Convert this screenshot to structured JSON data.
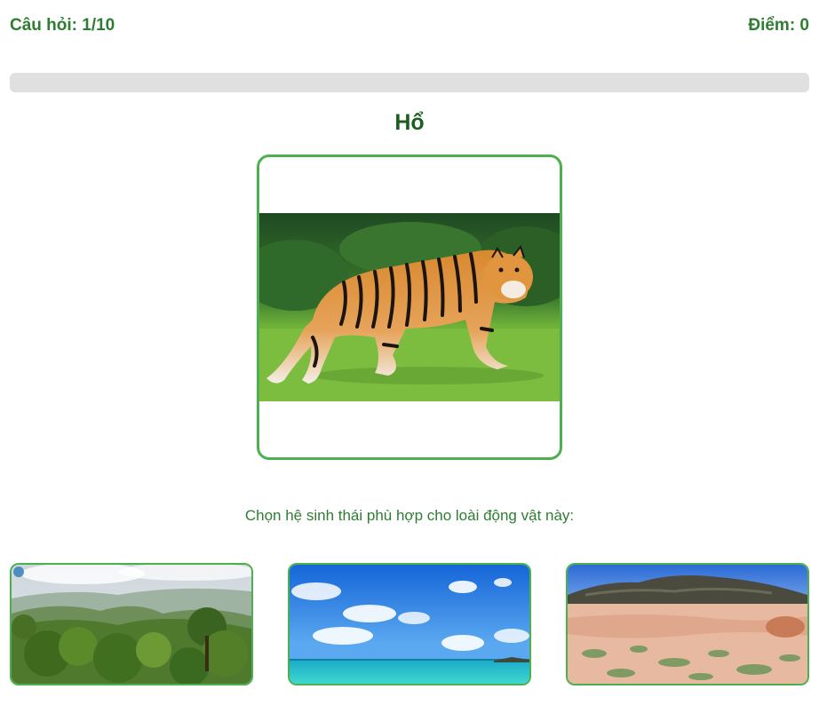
{
  "header": {
    "question_label": "Câu hỏi: 1/10",
    "score_label": "Điểm: 0"
  },
  "progress": {
    "fraction": 0
  },
  "animal": {
    "name": "Hổ"
  },
  "prompt": "Chọn hệ sinh thái phù hợp cho loài động vật này:",
  "options": [
    {
      "id": "forest",
      "image": "forest-image"
    },
    {
      "id": "ocean",
      "image": "ocean-image"
    },
    {
      "id": "desert",
      "image": "desert-image"
    }
  ],
  "colors": {
    "accent": "#4caf50",
    "text_green": "#2e7d32",
    "title_green": "#1b5e20",
    "track": "#e0e0e0"
  }
}
